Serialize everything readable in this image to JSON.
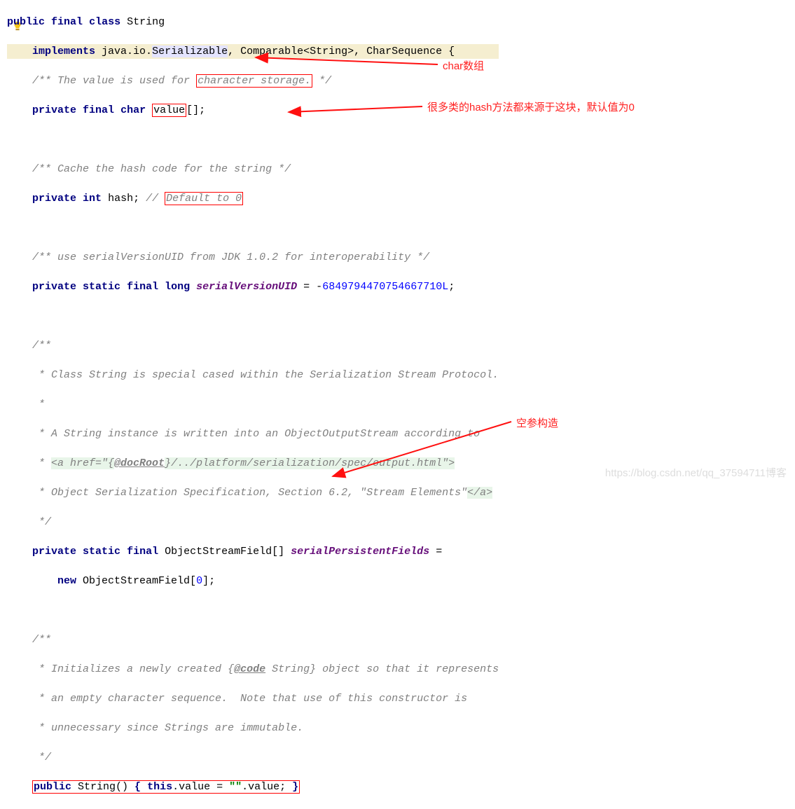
{
  "code": {
    "l1_public": "public",
    "l1_final": "final",
    "l1_class": "class",
    "l1_name": "String",
    "l2_implements": "implements",
    "l2_pkg1": "java.io.",
    "l2_serial": "Serializable",
    "l2_rest": ", Comparable<String>, CharSequence {",
    "c1a": "/** The value is used for ",
    "c1b": "character storage.",
    "c1c": " */",
    "l4_priv": "private",
    "l4_final": "final",
    "l4_char": "char",
    "l4_val": "value",
    "l4_br": "[];",
    "c2": "/** Cache the hash code for the string */",
    "l7_priv": "private",
    "l7_int": "int",
    "l7_hash": "hash;",
    "l7_c": "// ",
    "l7_def": "Default to 0",
    "c3": "/** use serialVersionUID from JDK 1.0.2 for interoperability */",
    "l10_priv": "private",
    "l10_static": "static",
    "l10_final": "final",
    "l10_long": "long",
    "l10_uid": "serialVersionUID",
    "l10_eq": " = -",
    "l10_num": "6849794470754667710L",
    "l10_semi": ";",
    "cb_open": "/**",
    "cb_1": " * Class String is special cased within the Serialization Stream Protocol.",
    "cb_2": " *",
    "cb_3a": " * A String instance is written into an ObjectOutputStream according to",
    "cb_4a": " * ",
    "cb_4b": "<a href=\"{",
    "cb_4c": "@docRoot",
    "cb_4d": "}/../platform/serialization/spec/output.html\">",
    "cb_5a": " * Object Serialization Specification, Section 6.2, \"Stream Elements\"",
    "cb_5b": "</a>",
    "cb_close": " */",
    "l19_priv": "private",
    "l19_static": "static",
    "l19_final": "final",
    "l19_type": "ObjectStreamField[] ",
    "l19_name": "serialPersistentFields",
    "l19_eq": " =",
    "l20_new": "new",
    "l20_rest": " ObjectStreamField[",
    "l20_zero": "0",
    "l20_end": "];",
    "cb2_open": "/**",
    "cb2_1a": " * Initializes a newly created {",
    "cb2_1b": "@code",
    "cb2_1c": " String} object so that it represents",
    "cb2_2": " * an empty character sequence.  Note that use of this constructor is",
    "cb2_3": " * unnecessary since Strings are immutable.",
    "cb2_close": " */",
    "ctor_pub": "public",
    "ctor_name": " String() ",
    "ctor_b1": "{",
    "ctor_this": " this",
    "ctor_dot": ".",
    "ctor_val": "value",
    "ctor_eq": " = ",
    "ctor_str": "\"\"",
    "ctor_dot2": ".value; ",
    "ctor_b2": "}"
  },
  "annotations": {
    "a1": "char数组",
    "a2": "很多类的hash方法都来源于这块，默认值为0",
    "a3": "空参构造"
  },
  "watermark": "https://blog.csdn.net/qq_37594711博客"
}
